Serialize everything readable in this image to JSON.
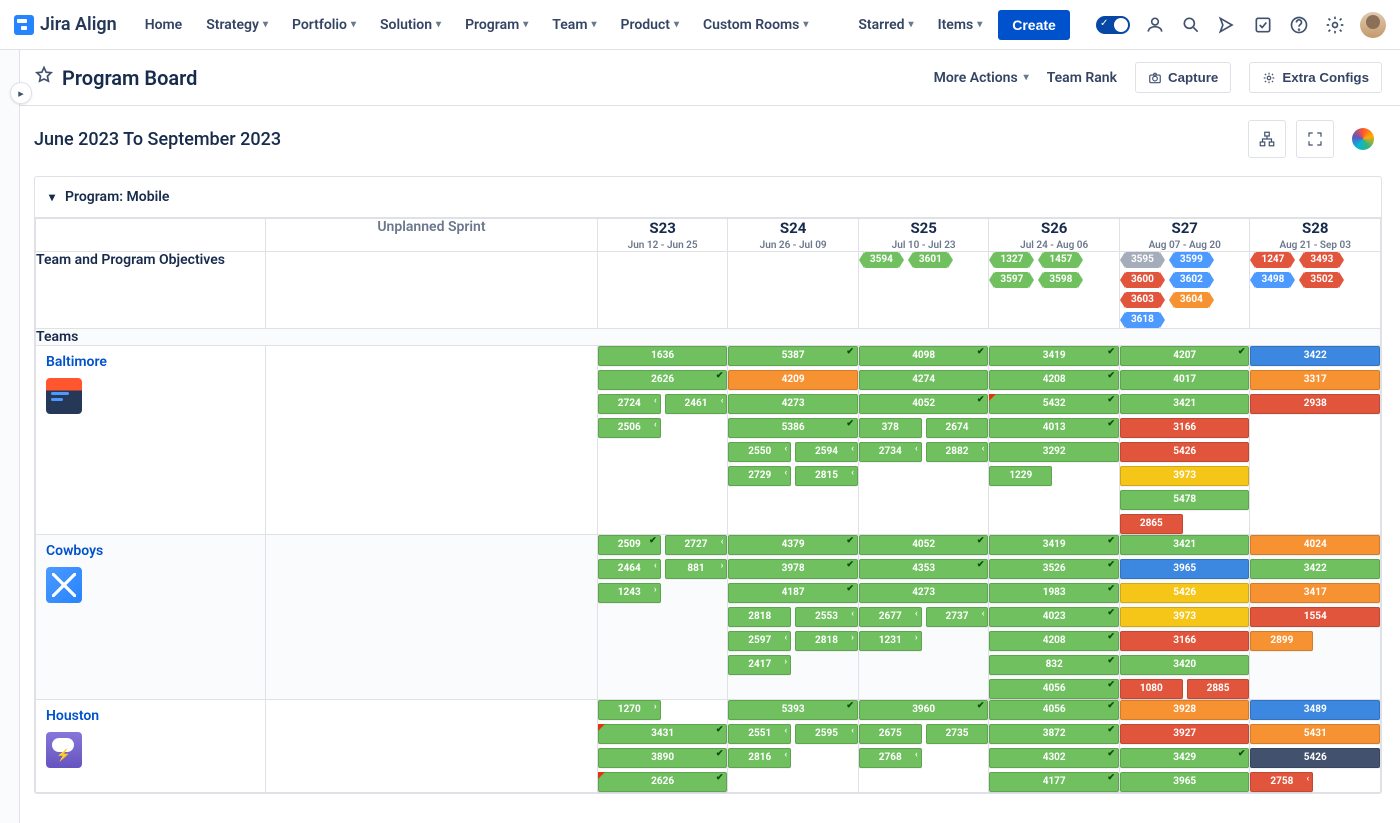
{
  "brand": "Jira Align",
  "nav": {
    "items": [
      "Home",
      "Strategy",
      "Portfolio",
      "Solution",
      "Program",
      "Team",
      "Product",
      "Custom Rooms"
    ],
    "items_caret": [
      false,
      true,
      true,
      true,
      true,
      true,
      true,
      true
    ],
    "secondary": [
      "Starred",
      "Items"
    ],
    "create": "Create"
  },
  "page": {
    "title": "Program Board",
    "more_actions": "More Actions",
    "team_rank": "Team Rank",
    "capture": "Capture",
    "extra_configs": "Extra Configs",
    "range": "June 2023 To September 2023",
    "program_label": "Program: Mobile",
    "unplanned": "Unplanned Sprint",
    "objectives_label": "Team and Program Objectives",
    "teams_label": "Teams"
  },
  "sprints": [
    {
      "name": "S23",
      "dates": "Jun 12 - Jun 25"
    },
    {
      "name": "S24",
      "dates": "Jun 26 - Jul 09"
    },
    {
      "name": "S25",
      "dates": "Jul 10 - Jul 23"
    },
    {
      "name": "S26",
      "dates": "Jul 24 - Aug 06"
    },
    {
      "name": "S27",
      "dates": "Aug 07 - Aug 20"
    },
    {
      "name": "S28",
      "dates": "Aug 21 - Sep 03"
    }
  ],
  "objectives": {
    "S23": [],
    "S24": [],
    "S25": [
      {
        "id": "3594",
        "c": "green"
      },
      {
        "id": "3601",
        "c": "green"
      }
    ],
    "S26": [
      {
        "id": "1327",
        "c": "green"
      },
      {
        "id": "1457",
        "c": "green"
      },
      {
        "id": "3597",
        "c": "green"
      },
      {
        "id": "3598",
        "c": "green"
      }
    ],
    "S27": [
      {
        "id": "3595",
        "c": "grey"
      },
      {
        "id": "3599",
        "c": "blue"
      },
      {
        "id": "3600",
        "c": "red"
      },
      {
        "id": "3602",
        "c": "blue"
      },
      {
        "id": "3603",
        "c": "red"
      },
      {
        "id": "3604",
        "c": "orange"
      },
      {
        "id": "3618",
        "c": "blue"
      }
    ],
    "S28": [
      {
        "id": "1247",
        "c": "red"
      },
      {
        "id": "3493",
        "c": "red"
      },
      {
        "id": "3498",
        "c": "blue"
      },
      {
        "id": "3502",
        "c": "red"
      }
    ]
  },
  "teams": [
    {
      "name": "Baltimore",
      "icon": "baltimore",
      "cells": {
        "S23": [
          {
            "id": "1636",
            "c": "green",
            "w": "full"
          },
          {
            "id": "2626",
            "c": "green",
            "w": "full",
            "check": true
          },
          {
            "id": "2724",
            "c": "green",
            "w": "half",
            "arrowL": true
          },
          {
            "id": "2461",
            "c": "green",
            "w": "half",
            "arrowL": true
          },
          {
            "id": "2506",
            "c": "green",
            "w": "half",
            "arrowL": true
          }
        ],
        "S24": [
          {
            "id": "5387",
            "c": "green",
            "w": "full",
            "check": true
          },
          {
            "id": "4209",
            "c": "orange",
            "w": "full"
          },
          {
            "id": "4273",
            "c": "green",
            "w": "full"
          },
          {
            "id": "5386",
            "c": "green",
            "w": "full",
            "check": true
          },
          {
            "id": "2550",
            "c": "green",
            "w": "half",
            "arrowL": true
          },
          {
            "id": "2594",
            "c": "green",
            "w": "half",
            "arrowL": true
          },
          {
            "id": "2729",
            "c": "green",
            "w": "half",
            "arrowL": true
          },
          {
            "id": "2815",
            "c": "green",
            "w": "half",
            "arrowL": true
          }
        ],
        "S25": [
          {
            "id": "4098",
            "c": "green",
            "w": "full",
            "check": true
          },
          {
            "id": "4274",
            "c": "green",
            "w": "full"
          },
          {
            "id": "4052",
            "c": "green",
            "w": "full",
            "check": true
          },
          {
            "id": "378",
            "c": "green",
            "w": "half"
          },
          {
            "id": "2674",
            "c": "green",
            "w": "half"
          },
          {
            "id": "2734",
            "c": "green",
            "w": "half",
            "arrowL": true
          },
          {
            "id": "2882",
            "c": "green",
            "w": "half",
            "arrowL": true
          }
        ],
        "S26": [
          {
            "id": "3419",
            "c": "green",
            "w": "full",
            "check": true
          },
          {
            "id": "4208",
            "c": "green",
            "w": "full",
            "check": true
          },
          {
            "id": "5432",
            "c": "green",
            "w": "full",
            "check": true,
            "flag": true
          },
          {
            "id": "4013",
            "c": "green",
            "w": "full",
            "check": true
          },
          {
            "id": "3292",
            "c": "green",
            "w": "full"
          },
          {
            "id": "1229",
            "c": "green",
            "w": "half"
          }
        ],
        "S27": [
          {
            "id": "4207",
            "c": "green",
            "w": "full",
            "check": true
          },
          {
            "id": "4017",
            "c": "green",
            "w": "full"
          },
          {
            "id": "3421",
            "c": "green",
            "w": "full"
          },
          {
            "id": "3166",
            "c": "red",
            "w": "full"
          },
          {
            "id": "5426",
            "c": "red",
            "w": "full"
          },
          {
            "id": "3973",
            "c": "yellow",
            "w": "full"
          },
          {
            "id": "5478",
            "c": "green",
            "w": "full"
          },
          {
            "id": "2865",
            "c": "red",
            "w": "half"
          }
        ],
        "S28": [
          {
            "id": "3422",
            "c": "blueCard",
            "w": "full"
          },
          {
            "id": "3317",
            "c": "orange",
            "w": "full"
          },
          {
            "id": "2938",
            "c": "red",
            "w": "full"
          }
        ]
      }
    },
    {
      "name": "Cowboys",
      "icon": "cowboys",
      "cells": {
        "S23": [
          {
            "id": "2509",
            "c": "green",
            "w": "half",
            "check": true
          },
          {
            "id": "2727",
            "c": "green",
            "w": "half",
            "arrowL": true
          },
          {
            "id": "2464",
            "c": "green",
            "w": "half",
            "arrowL": true
          },
          {
            "id": "881",
            "c": "green",
            "w": "half",
            "arrow": true
          },
          {
            "id": "1243",
            "c": "green",
            "w": "half",
            "arrow": true
          }
        ],
        "S24": [
          {
            "id": "4379",
            "c": "green",
            "w": "full",
            "check": true
          },
          {
            "id": "3978",
            "c": "green",
            "w": "full",
            "check": true
          },
          {
            "id": "4187",
            "c": "green",
            "w": "full",
            "check": true
          },
          {
            "id": "2818",
            "c": "green",
            "w": "half"
          },
          {
            "id": "2553",
            "c": "green",
            "w": "half",
            "arrowL": true
          },
          {
            "id": "2597",
            "c": "green",
            "w": "half",
            "arrowL": true
          },
          {
            "id": "2818",
            "c": "green",
            "w": "half",
            "arrow": true
          },
          {
            "id": "2417",
            "c": "green",
            "w": "half",
            "arrow": true
          }
        ],
        "S25": [
          {
            "id": "4052",
            "c": "green",
            "w": "full",
            "check": true
          },
          {
            "id": "4353",
            "c": "green",
            "w": "full",
            "check": true
          },
          {
            "id": "4273",
            "c": "green",
            "w": "full"
          },
          {
            "id": "2677",
            "c": "green",
            "w": "half",
            "arrowL": true
          },
          {
            "id": "2737",
            "c": "green",
            "w": "half",
            "arrowL": true
          },
          {
            "id": "1231",
            "c": "green",
            "w": "half",
            "arrow": true
          }
        ],
        "S26": [
          {
            "id": "3419",
            "c": "green",
            "w": "full",
            "check": true
          },
          {
            "id": "3526",
            "c": "green",
            "w": "full",
            "check": true
          },
          {
            "id": "1983",
            "c": "green",
            "w": "full",
            "check": true
          },
          {
            "id": "4023",
            "c": "green",
            "w": "full",
            "check": true
          },
          {
            "id": "4208",
            "c": "green",
            "w": "full",
            "check": true
          },
          {
            "id": "832",
            "c": "green",
            "w": "full",
            "check": true
          },
          {
            "id": "4056",
            "c": "green",
            "w": "full",
            "check": true
          }
        ],
        "S27": [
          {
            "id": "3421",
            "c": "green",
            "w": "full"
          },
          {
            "id": "3965",
            "c": "blueCard",
            "w": "full"
          },
          {
            "id": "5426",
            "c": "yellow",
            "w": "full"
          },
          {
            "id": "3973",
            "c": "yellow",
            "w": "full"
          },
          {
            "id": "3166",
            "c": "red",
            "w": "full"
          },
          {
            "id": "3420",
            "c": "green",
            "w": "full"
          },
          {
            "id": "1080",
            "c": "red",
            "w": "half"
          },
          {
            "id": "2885",
            "c": "red",
            "w": "half"
          }
        ],
        "S28": [
          {
            "id": "4024",
            "c": "orange",
            "w": "full"
          },
          {
            "id": "3422",
            "c": "green",
            "w": "full"
          },
          {
            "id": "3417",
            "c": "orange",
            "w": "full"
          },
          {
            "id": "1554",
            "c": "red",
            "w": "full"
          },
          {
            "id": "2899",
            "c": "orange",
            "w": "half"
          }
        ]
      }
    },
    {
      "name": "Houston",
      "icon": "houston",
      "cells": {
        "S23": [
          {
            "id": "1270",
            "c": "green",
            "w": "half",
            "arrow": true
          },
          {
            "id": "3431",
            "c": "green",
            "w": "full",
            "check": true,
            "flag": true
          },
          {
            "id": "3890",
            "c": "green",
            "w": "full",
            "check": true
          },
          {
            "id": "2626",
            "c": "green",
            "w": "full",
            "check": true,
            "flag": true
          }
        ],
        "S24": [
          {
            "id": "5393",
            "c": "green",
            "w": "full",
            "check": true
          },
          {
            "id": "2551",
            "c": "green",
            "w": "half",
            "arrowL": true
          },
          {
            "id": "2595",
            "c": "green",
            "w": "half",
            "arrowL": true
          },
          {
            "id": "2816",
            "c": "green",
            "w": "half",
            "arrowL": true
          }
        ],
        "S25": [
          {
            "id": "3960",
            "c": "green",
            "w": "full",
            "check": true
          },
          {
            "id": "2675",
            "c": "green",
            "w": "half"
          },
          {
            "id": "2735",
            "c": "green",
            "w": "half"
          },
          {
            "id": "2768",
            "c": "green",
            "w": "half",
            "arrowL": true
          }
        ],
        "S26": [
          {
            "id": "4056",
            "c": "green",
            "w": "full",
            "check": true
          },
          {
            "id": "3872",
            "c": "green",
            "w": "full",
            "check": true
          },
          {
            "id": "4302",
            "c": "green",
            "w": "full",
            "check": true
          },
          {
            "id": "4177",
            "c": "green",
            "w": "full",
            "check": true
          }
        ],
        "S27": [
          {
            "id": "3928",
            "c": "orange",
            "w": "full"
          },
          {
            "id": "3927",
            "c": "red",
            "w": "full"
          },
          {
            "id": "3429",
            "c": "green",
            "w": "full",
            "check": true
          },
          {
            "id": "3965",
            "c": "green",
            "w": "full"
          }
        ],
        "S28": [
          {
            "id": "3489",
            "c": "blueCard",
            "w": "full"
          },
          {
            "id": "5431",
            "c": "orange",
            "w": "full"
          },
          {
            "id": "5426",
            "c": "dark",
            "w": "full"
          },
          {
            "id": "2758",
            "c": "red",
            "w": "half",
            "arrowL": true
          }
        ]
      }
    }
  ],
  "colors": {
    "green": "#70c060",
    "orange": "#F79232",
    "yellow": "#F5C518",
    "red": "#E2553D",
    "blue": "#4C9AFF",
    "blueCard": "#3C87E0",
    "grey": "#A5ADBA",
    "dark": "#42526E"
  }
}
